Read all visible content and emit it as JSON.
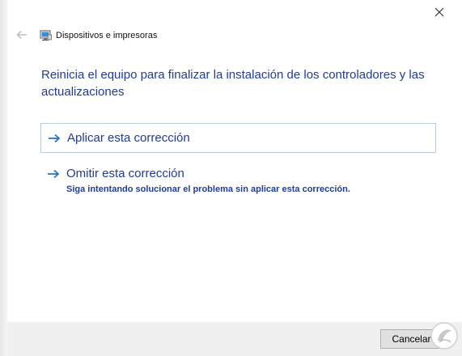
{
  "window": {
    "title": "Dispositivos e impresoras",
    "close_icon": "close-icon",
    "back_icon": "back-arrow-icon",
    "app_icon": "devices-printers-icon"
  },
  "heading": "Reinicia el equipo para finalizar la instalación de los controladores y las actualizaciones",
  "options": [
    {
      "label": "Aplicar esta corrección",
      "icon": "arrow-right-icon",
      "selected": true
    },
    {
      "label": "Omitir esta corrección",
      "description": "Siga intentando solucionar el problema sin aplicar esta corrección.",
      "icon": "arrow-right-icon"
    }
  ],
  "footer": {
    "cancel_label": "Cancelar"
  },
  "colors": {
    "link_blue": "#1f3c99",
    "arrow_blue": "#1e73c8",
    "selected_border": "#b9cbe0",
    "footer_bg": "#f0f0f0"
  }
}
